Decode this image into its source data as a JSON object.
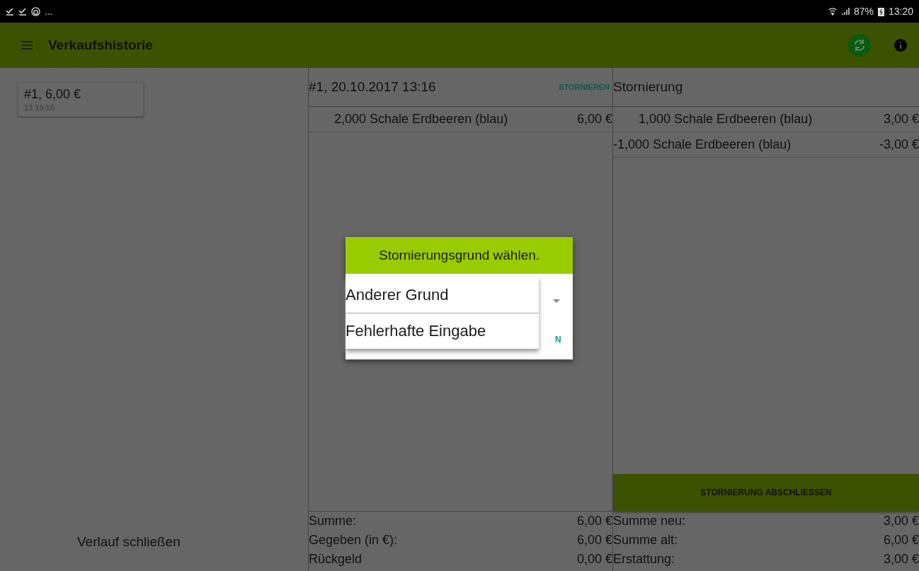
{
  "status_bar": {
    "overflow": "...",
    "battery": "87%",
    "time": "13:20"
  },
  "app_bar": {
    "title": "Verkaufshistorie"
  },
  "history": {
    "items": [
      {
        "title": "#1, 6,00 €",
        "time": "13:16:16",
        "selected": false
      }
    ],
    "close_label": "Verlauf schließen"
  },
  "sale": {
    "title": "#1, 20.10.2017 13:16",
    "action": "STORNIEREN",
    "lines": [
      {
        "text": "2,000 Schale Erdbeeren (blau)",
        "amount": "6,00 €"
      }
    ],
    "totals": [
      {
        "label": "Summe:",
        "value": "6,00 €"
      },
      {
        "label": "Gegeben (in €):",
        "value": "6,00 €"
      },
      {
        "label": "Rückgeld",
        "value": "0,00 €"
      }
    ]
  },
  "cancellation": {
    "title": "Stornierung",
    "lines": [
      {
        "text": "1,000 Schale Erdbeeren (blau)",
        "amount": "3,00 €",
        "kind": "indented"
      },
      {
        "text": "-1,000 Schale Erdbeeren (blau)",
        "amount": "-3,00 €",
        "kind": "plain"
      }
    ],
    "action": "STORNIERUNG ABSCHLIESSEN",
    "totals": [
      {
        "label": "Summe neu:",
        "value": "3,00 €"
      },
      {
        "label": "Summe alt:",
        "value": "6,00 €"
      },
      {
        "label": "Erstattung:",
        "value": "3,00 €"
      }
    ]
  },
  "dialog": {
    "title": "Stornierungsgrund wählen.",
    "button_visible_part": "N",
    "options": [
      {
        "label": "Anderer Grund"
      },
      {
        "label": "Fehlerhafte Eingabe"
      }
    ]
  }
}
